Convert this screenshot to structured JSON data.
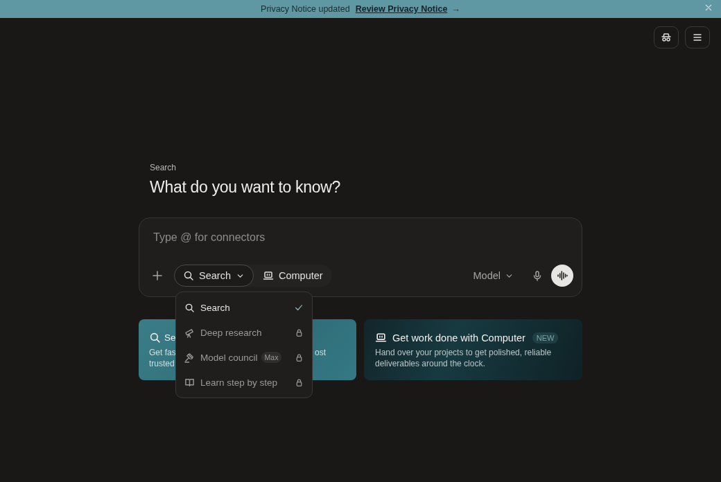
{
  "banner": {
    "text": "Privacy Notice updated",
    "link": "Review Privacy Notice",
    "arrow": "→"
  },
  "top_buttons": [
    {
      "kind": "incognito"
    },
    {
      "kind": "menu"
    }
  ],
  "mode_label": "Search",
  "heading": "What do you want to know?",
  "composer": {
    "placeholder": "Type @ for connectors",
    "modes": [
      {
        "kind": "search",
        "label": "Search",
        "selected": true,
        "dropdown": true
      },
      {
        "kind": "computer",
        "label": "Computer",
        "selected": false,
        "dropdown": false
      }
    ],
    "model": "Model"
  },
  "menu": [
    {
      "kind": "search",
      "label": "Search",
      "selected": true,
      "locked": false
    },
    {
      "kind": "telescope",
      "label": "Deep research",
      "selected": false,
      "locked": true
    },
    {
      "kind": "gavel",
      "label": "Model council",
      "badge": "Max",
      "selected": false,
      "locked": true
    },
    {
      "kind": "book",
      "label": "Learn step by step",
      "selected": false,
      "locked": true
    }
  ],
  "cards": [
    {
      "kind": "search",
      "title": "Se",
      "lines": [
        [
          "Get fas",
          "ost"
        ],
        [
          "trusted"
        ]
      ]
    },
    {
      "kind": "computer",
      "title": "Get work done with Computer",
      "badge": "NEW",
      "lines": [
        [
          "Hand over your projects to get polished, reliable"
        ],
        [
          "deliverables around the clock."
        ]
      ]
    }
  ]
}
